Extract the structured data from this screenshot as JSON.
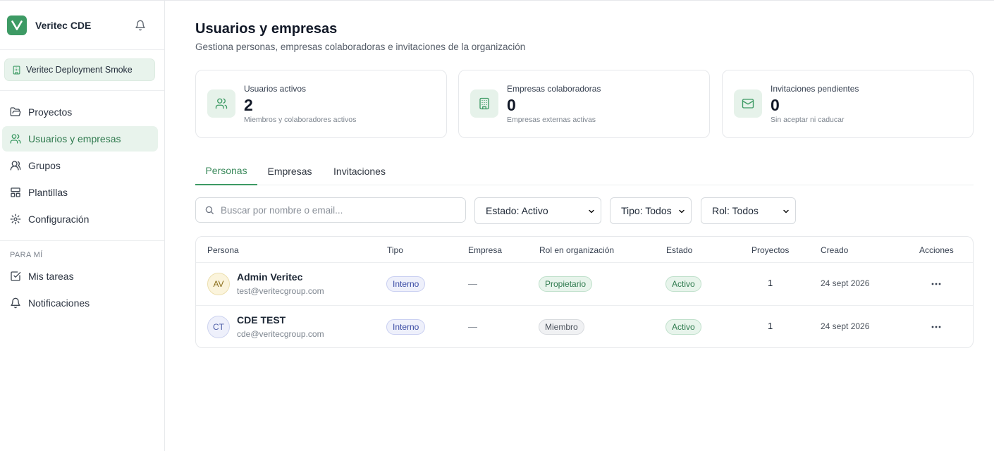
{
  "brand": {
    "name": "Veritec CDE",
    "accent": "#3d9a64"
  },
  "organization": {
    "name": "Veritec Deployment Smoke"
  },
  "nav": {
    "items": [
      {
        "label": "Proyectos",
        "icon": "folder-icon"
      },
      {
        "label": "Usuarios y empresas",
        "icon": "users-icon",
        "active": true
      },
      {
        "label": "Grupos",
        "icon": "group-icon"
      },
      {
        "label": "Plantillas",
        "icon": "template-icon"
      },
      {
        "label": "Configuración",
        "icon": "gear-icon"
      }
    ],
    "section_label": "PARA MÍ",
    "personal": [
      {
        "label": "Mis tareas",
        "icon": "checkbox-icon"
      },
      {
        "label": "Notificaciones",
        "icon": "bell-icon"
      }
    ]
  },
  "page": {
    "title": "Usuarios y empresas",
    "subtitle": "Gestiona personas, empresas colaboradoras e invitaciones de la organización"
  },
  "stats": [
    {
      "label": "Usuarios activos",
      "value": "2",
      "desc": "Miembros y colaboradores activos",
      "icon": "users-icon"
    },
    {
      "label": "Empresas colaboradoras",
      "value": "0",
      "desc": "Empresas externas activas",
      "icon": "building-icon"
    },
    {
      "label": "Invitaciones pendientes",
      "value": "0",
      "desc": "Sin aceptar ni caducar",
      "icon": "mail-icon"
    }
  ],
  "tabs": [
    {
      "label": "Personas",
      "active": true
    },
    {
      "label": "Empresas"
    },
    {
      "label": "Invitaciones"
    }
  ],
  "filters": {
    "search_placeholder": "Buscar por nombre o email...",
    "estado": "Estado: Activo",
    "tipo": "Tipo: Todos",
    "rol": "Rol: Todos"
  },
  "table": {
    "headers": [
      "Persona",
      "Tipo",
      "Empresa",
      "Rol en organización",
      "Estado",
      "Proyectos",
      "Creado",
      "Acciones"
    ],
    "rows": [
      {
        "initials": "AV",
        "name": "Admin Veritec",
        "email": "test@veritecgroup.com",
        "tipo": "Interno",
        "empresa": "—",
        "rol": "Propietario",
        "estado": "Activo",
        "proyectos": "1",
        "creado": "24 sept 2026"
      },
      {
        "initials": "CT",
        "name": "CDE TEST",
        "email": "cde@veritecgroup.com",
        "tipo": "Interno",
        "empresa": "—",
        "rol": "Miembro",
        "estado": "Activo",
        "proyectos": "1",
        "creado": "24 sept 2026"
      }
    ]
  }
}
